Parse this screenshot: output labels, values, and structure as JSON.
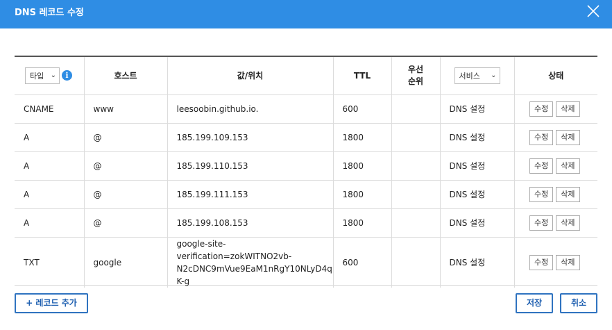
{
  "dialog": {
    "title": "DNS 레코드 수정",
    "accent_color": "#2f8de4"
  },
  "table": {
    "type_filter": {
      "selected": "타입",
      "info_icon": "info-icon"
    },
    "headers": {
      "host": "호스트",
      "value": "값/위치",
      "ttl": "TTL",
      "priority_line1": "우선",
      "priority_line2": "순위",
      "status": "상태"
    },
    "service_filter": {
      "selected": "서비스"
    },
    "rows": [
      {
        "type": "CNAME",
        "host": "www",
        "value": "leesoobin.github.io.",
        "ttl": "600",
        "priority": "",
        "service": "DNS 설정",
        "edit": "수정",
        "delete": "삭제"
      },
      {
        "type": "A",
        "host": "@",
        "value": "185.199.109.153",
        "ttl": "1800",
        "priority": "",
        "service": "DNS 설정",
        "edit": "수정",
        "delete": "삭제"
      },
      {
        "type": "A",
        "host": "@",
        "value": "185.199.110.153",
        "ttl": "1800",
        "priority": "",
        "service": "DNS 설정",
        "edit": "수정",
        "delete": "삭제"
      },
      {
        "type": "A",
        "host": "@",
        "value": "185.199.111.153",
        "ttl": "1800",
        "priority": "",
        "service": "DNS 설정",
        "edit": "수정",
        "delete": "삭제"
      },
      {
        "type": "A",
        "host": "@",
        "value": "185.199.108.153",
        "ttl": "1800",
        "priority": "",
        "service": "DNS 설정",
        "edit": "수정",
        "delete": "삭제"
      },
      {
        "type": "TXT",
        "host": "google",
        "value_line1": "google-site-verification=zokWITNO2vb-",
        "value_line2": "N2cDNC9mVue9EaM1nRgY10NLyD4q",
        "value_line3": "K-g",
        "ttl": "600",
        "priority": "",
        "service": "DNS 설정",
        "edit": "수정",
        "delete": "삭제"
      }
    ]
  },
  "footer": {
    "add_record": "+ 레코드 추가",
    "save": "저장",
    "cancel": "취소"
  }
}
